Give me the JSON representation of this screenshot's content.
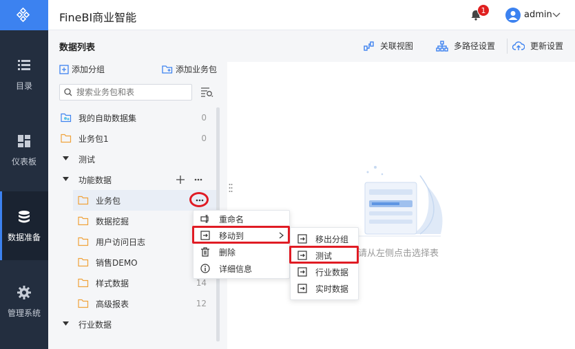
{
  "app": {
    "title": "FineBI商业智能"
  },
  "header": {
    "notification_count": "1",
    "username": "admin"
  },
  "nav": {
    "items": [
      {
        "label": "目录",
        "icon": "list-icon"
      },
      {
        "label": "仪表板",
        "icon": "dashboard-icon"
      },
      {
        "label": "数据准备",
        "icon": "database-icon",
        "active": true
      },
      {
        "label": "管理系统",
        "icon": "gear-icon"
      }
    ]
  },
  "panel": {
    "title": "数据列表",
    "tools": {
      "relation_view": "关联视图",
      "multi_path": "多路径设置",
      "update": "更新设置"
    },
    "add_group": "添加分组",
    "add_package": "添加业务包",
    "search_placeholder": "搜索业务包和表"
  },
  "tree": [
    {
      "label": "我的自助数据集",
      "count": "0",
      "type": "self-dataset"
    },
    {
      "label": "业务包1",
      "count": "0",
      "type": "folder"
    },
    {
      "label": "测试",
      "type": "group"
    },
    {
      "label": "功能数据",
      "type": "group"
    },
    {
      "label": "业务包",
      "type": "folder",
      "selected": true
    },
    {
      "label": "数据挖掘",
      "type": "folder"
    },
    {
      "label": "用户访问日志",
      "type": "folder"
    },
    {
      "label": "销售DEMO",
      "type": "folder"
    },
    {
      "label": "样式数据",
      "count": "14",
      "type": "folder"
    },
    {
      "label": "高级报表",
      "count": "12",
      "type": "folder"
    },
    {
      "label": "行业数据",
      "type": "group"
    }
  ],
  "context_menu": {
    "items": [
      "重命名",
      "移动到",
      "删除",
      "详细信息"
    ]
  },
  "submenu": {
    "items": [
      "移出分组",
      "测试",
      "行业数据",
      "实时数据"
    ]
  },
  "empty_state": {
    "text": "请从左侧点击选择表"
  },
  "colors": {
    "accent": "#3c82f0",
    "nav_bg": "#232e3f",
    "highlight": "#e01b24",
    "folder": "#f0a23a"
  }
}
